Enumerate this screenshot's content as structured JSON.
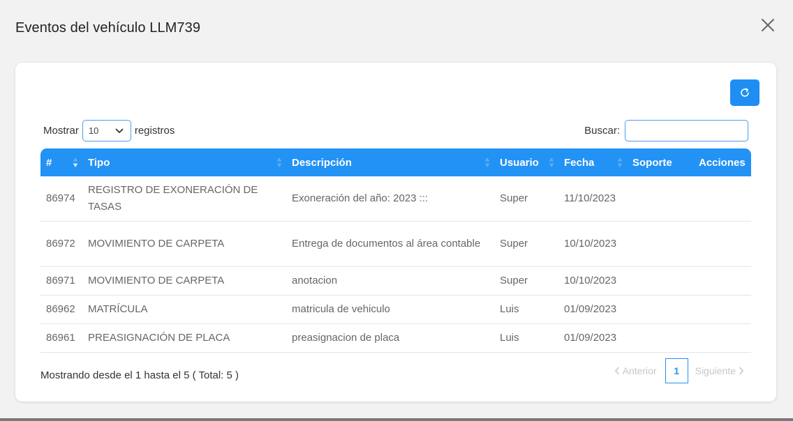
{
  "modal": {
    "title": "Eventos del vehículo LLM739"
  },
  "icons": {
    "close": "close-icon",
    "refresh": "refresh-icon",
    "chevron": "chevron-down-icon",
    "sort": "sort-icon"
  },
  "colors": {
    "accent": "#2292f5",
    "background": "#f2f2f2"
  },
  "length": {
    "prefix": "Mostrar",
    "value": "10",
    "suffix": "registros"
  },
  "search": {
    "label": "Buscar:",
    "value": "",
    "placeholder": ""
  },
  "table": {
    "columns": [
      "#",
      "Tipo",
      "Descripción",
      "Usuario",
      "Fecha",
      "Soporte",
      "Acciones"
    ],
    "rows": [
      {
        "id": "86974",
        "tipo": "REGISTRO DE EXONERACIÓN DE TASAS",
        "descripcion": "Exoneración del año: 2023 :::",
        "usuario": "Super",
        "fecha": "11/10/2023",
        "soporte": "",
        "acciones": ""
      },
      {
        "id": "86972",
        "tipo": "MOVIMIENTO DE CARPETA",
        "descripcion": "Entrega de documentos al área contable",
        "usuario": "Super",
        "fecha": "10/10/2023",
        "soporte": "",
        "acciones": ""
      },
      {
        "id": "86971",
        "tipo": "MOVIMIENTO DE CARPETA",
        "descripcion": "anotacion",
        "usuario": "Super",
        "fecha": "10/10/2023",
        "soporte": "",
        "acciones": ""
      },
      {
        "id": "86962",
        "tipo": "MATRÍCULA",
        "descripcion": "matricula de vehiculo",
        "usuario": "Luis",
        "fecha": "01/09/2023",
        "soporte": "",
        "acciones": ""
      },
      {
        "id": "86961",
        "tipo": "PREASIGNACIÓN DE PLACA",
        "descripcion": "preasignacion de placa",
        "usuario": "Luis",
        "fecha": "01/09/2023",
        "soporte": "",
        "acciones": ""
      }
    ]
  },
  "footer": {
    "info": "Mostrando desde el 1 hasta el 5 ( Total: 5 )",
    "prev": "Anterior",
    "page": "1",
    "next": "Siguiente"
  }
}
